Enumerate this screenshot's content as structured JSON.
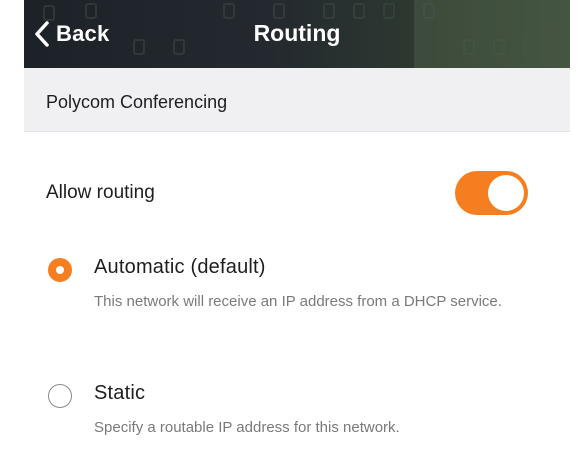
{
  "navbar": {
    "back_label": "Back",
    "title": "Routing",
    "back_icon": "chevron-left-icon"
  },
  "section": {
    "title": "Polycom Conferencing"
  },
  "allow_routing": {
    "label": "Allow routing",
    "enabled": true
  },
  "routing_options": [
    {
      "title": "Automatic (default)",
      "description": "This network will receive an IP address from a DHCP service.",
      "selected": true
    },
    {
      "title": "Static",
      "description": "Specify a routable IP address for this network.",
      "selected": false
    }
  ],
  "colors": {
    "accent": "#f57f20",
    "navbar_bg": "#23292f",
    "section_bg": "#f0f0f2",
    "text_primary": "#1e1e1e",
    "text_secondary": "#7a7a7a"
  }
}
